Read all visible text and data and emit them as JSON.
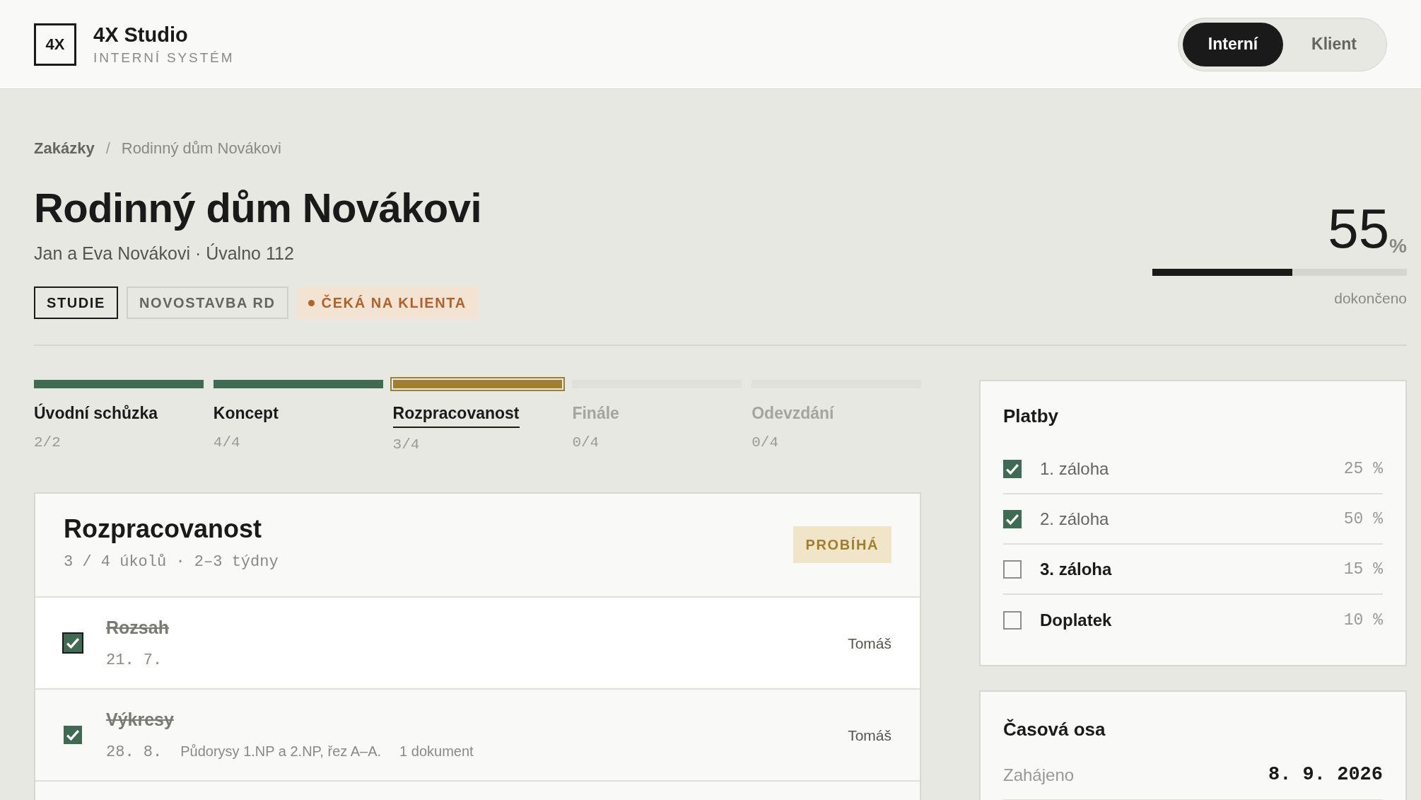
{
  "header": {
    "logo": "4X",
    "title": "4X Studio",
    "subtitle": "INTERNÍ SYSTÉM",
    "view_toggle": [
      {
        "label": "Interní",
        "selected": true
      },
      {
        "label": "Klient",
        "selected": false
      }
    ]
  },
  "breadcrumb": [
    {
      "label": "Zakázky",
      "kind": "link"
    },
    {
      "label": "/",
      "kind": "separator"
    },
    {
      "label": "Rodinný dům Novákovi",
      "kind": "current"
    }
  ],
  "project": {
    "title": "Rodinný dům Novákovi",
    "subtitle": "Jan a Eva Novákovi · Úvalno 112",
    "tags": [
      {
        "label": "STUDIE",
        "kind": "primary"
      },
      {
        "label": "NOVOSTAVBA RD",
        "kind": "outline"
      },
      {
        "label": "ČEKÁ NA KLIENTA",
        "kind": "status"
      }
    ],
    "progress": {
      "value": "55",
      "unit": "%",
      "level": 0.55,
      "label": "dokončeno"
    }
  },
  "stages": [
    {
      "label": "Úvodní schůzka",
      "count": "2/2",
      "completed": true,
      "selected": false
    },
    {
      "label": "Koncept",
      "count": "4/4",
      "completed": true,
      "selected": false
    },
    {
      "label": "Rozpracovanost",
      "count": "3/4",
      "completed": false,
      "selected": true
    },
    {
      "label": "Finále",
      "count": "0/4",
      "completed": false,
      "selected": false
    },
    {
      "label": "Odevzdání",
      "count": "0/4",
      "completed": false,
      "selected": false
    }
  ],
  "stage_panel": {
    "title": "Rozpracovanost",
    "meta": "3 / 4 úkolů · 2–3 týdny",
    "badge": "PROBÍHÁ",
    "tasks": [
      {
        "title": "Rozsah",
        "date": "21. 7.",
        "assignee": "Tomáš",
        "checked": true,
        "selected": true
      },
      {
        "title": "Výkresy",
        "date": "28. 8.",
        "note": "Půdorysy 1.NP a 2.NP, řez A–A.",
        "attachments": "1 dokument",
        "assignee": "Tomáš",
        "checked": true,
        "selected": false
      }
    ]
  },
  "payments": {
    "title": "Platby",
    "items": [
      {
        "label": "1. záloha",
        "share": "25 %",
        "checked": true
      },
      {
        "label": "2. záloha",
        "share": "50 %",
        "checked": true
      },
      {
        "label": "3. záloha",
        "share": "15 %",
        "checked": false
      },
      {
        "label": "Doplatek",
        "share": "10 %",
        "checked": false
      }
    ]
  },
  "timeline": {
    "title": "Časová osa",
    "rows": [
      {
        "label": "Zahájeno",
        "value": "8. 9. 2026"
      }
    ]
  }
}
